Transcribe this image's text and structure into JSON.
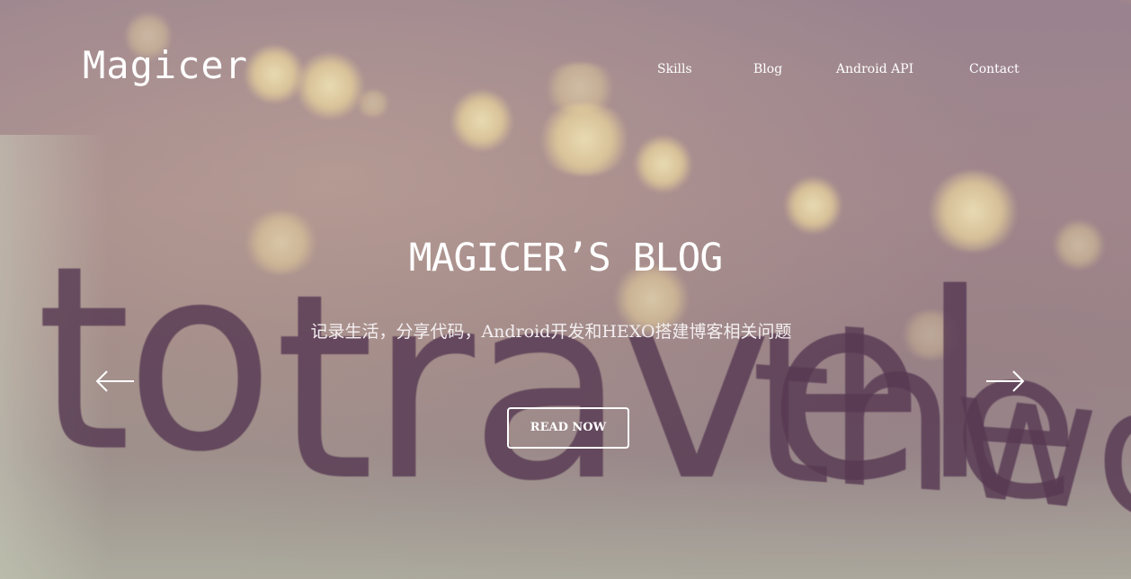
{
  "header": {
    "logo": "Magicer",
    "nav": [
      {
        "label": "Skills"
      },
      {
        "label": "Blog"
      },
      {
        "label": "Android API"
      },
      {
        "label": "Contact"
      }
    ]
  },
  "hero": {
    "title": "MAGICER’S BLOG",
    "subtitle": "记录生活，分享代码，Android开发和HEXO搭建博客相关问题",
    "button_label": "READ NOW",
    "background_text": [
      "to",
      "travel",
      "the",
      "wor"
    ],
    "prev_icon": "arrow-left-icon",
    "next_icon": "arrow-right-icon"
  },
  "colors": {
    "text": "#ffffff",
    "background": "#a08c8e",
    "background_lettering": "#4a2c47"
  }
}
